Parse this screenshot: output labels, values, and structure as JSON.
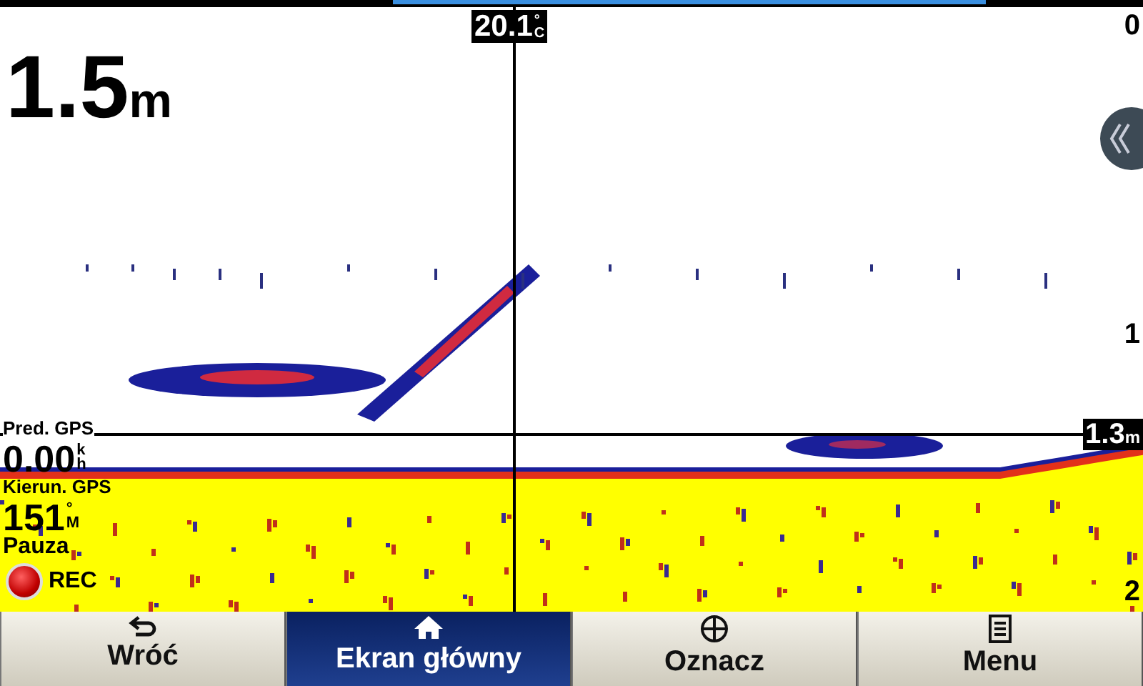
{
  "depth": {
    "value": "1.5",
    "unit": "m"
  },
  "water_temperature": {
    "value": "20.1",
    "unit_top": "°",
    "unit_bottom": "C"
  },
  "depth_scale": [
    "0",
    "1",
    "2"
  ],
  "cursor_depth": {
    "value": "1.3",
    "unit": "m"
  },
  "gps_speed": {
    "label": "Pred. GPS",
    "value": "0.00",
    "unit_top": "k",
    "unit_bottom": "h"
  },
  "gps_heading": {
    "label": "Kierun. GPS",
    "value": "151",
    "unit_top": "°",
    "unit_bottom": "M"
  },
  "playback": {
    "status": "Pauza",
    "record_label": "REC"
  },
  "buttons": [
    {
      "kind": "back",
      "label": "Wróć",
      "selected": false
    },
    {
      "kind": "home",
      "label": "Ekran główny",
      "selected": true
    },
    {
      "kind": "mark",
      "label": "Oznacz",
      "selected": false
    },
    {
      "kind": "menu",
      "label": "Menu",
      "selected": false
    }
  ]
}
